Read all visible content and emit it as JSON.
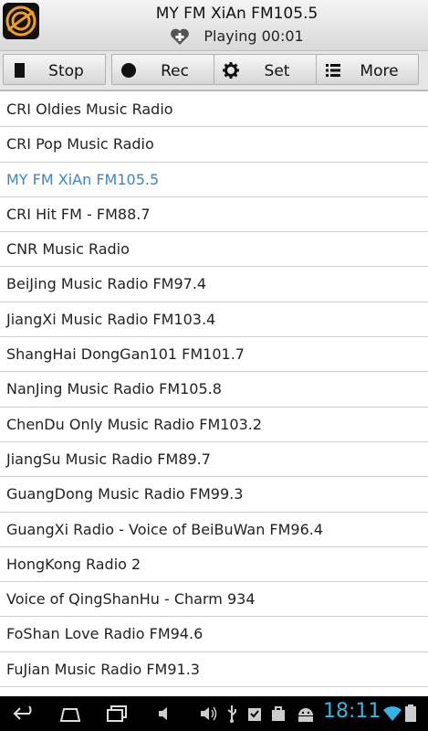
{
  "header": {
    "title": "MY FM XiAn FM105.5",
    "status": "Playing  00:01"
  },
  "toolbar": {
    "stop_label": "Stop",
    "rec_label": "Rec",
    "set_label": "Set",
    "more_label": "More"
  },
  "stations": [
    "CRI Oldies Music Radio",
    "CRI Pop Music Radio",
    "MY FM XiAn FM105.5",
    "CRI Hit FM - FM88.7",
    "CNR Music Radio",
    "BeiJing Music Radio FM97.4",
    "JiangXi Music Radio FM103.4",
    "ShangHai DongGan101 FM101.7",
    "NanJing Music Radio FM105.8",
    "ChenDu Only Music Radio FM103.2",
    "JiangSu Music Radio FM89.7",
    "GuangDong Music Radio FM99.3",
    "GuangXi Radio - Voice of BeiBuWan FM96.4",
    "HongKong Radio 2",
    "Voice of QingShanHu - Charm 934",
    "FoShan Love Radio FM94.6",
    "FuJian Music Radio FM91.3"
  ],
  "active_index": 2,
  "navbar": {
    "time": "18:11"
  },
  "colors": {
    "active": "#3a86c8",
    "clock": "#33b5e5",
    "logo_accent": "#f0a020"
  }
}
